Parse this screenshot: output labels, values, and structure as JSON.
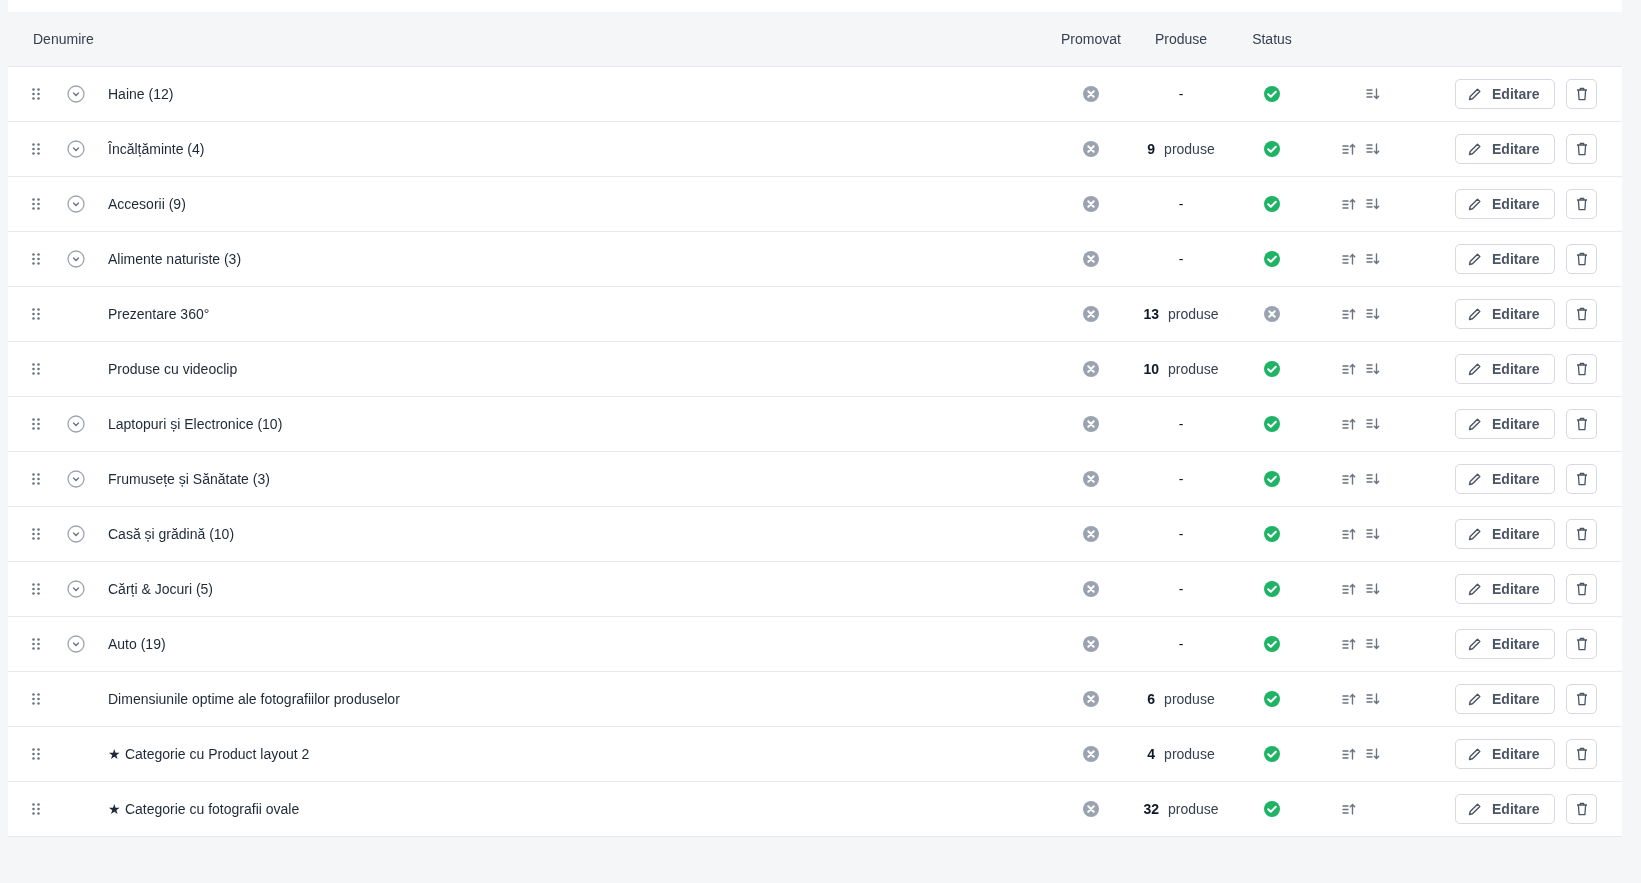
{
  "table": {
    "columns": [
      {
        "label": "Denumire"
      },
      {
        "label": "Promovat"
      },
      {
        "label": "Produse"
      },
      {
        "label": "Status"
      }
    ],
    "rows": [
      {
        "name": "Haine (12)",
        "expandable": true,
        "promoted": false,
        "products": {
          "empty": "-"
        },
        "active": true,
        "move_up": false,
        "move_down": true,
        "edit_label": "Editare"
      },
      {
        "name": "Încălțăminte (4)",
        "expandable": true,
        "promoted": false,
        "products": {
          "count": "9",
          "unit": "produse"
        },
        "active": true,
        "move_up": true,
        "move_down": true,
        "edit_label": "Editare"
      },
      {
        "name": "Accesorii (9)",
        "expandable": true,
        "promoted": false,
        "products": {
          "empty": "-"
        },
        "active": true,
        "move_up": true,
        "move_down": true,
        "edit_label": "Editare"
      },
      {
        "name": "Alimente naturiste (3)",
        "expandable": true,
        "promoted": false,
        "products": {
          "empty": "-"
        },
        "active": true,
        "move_up": true,
        "move_down": true,
        "edit_label": "Editare"
      },
      {
        "name": "Prezentare 360°",
        "expandable": false,
        "promoted": false,
        "products": {
          "count": "13",
          "unit": "produse"
        },
        "active": false,
        "move_up": true,
        "move_down": true,
        "edit_label": "Editare"
      },
      {
        "name": "Produse cu videoclip",
        "expandable": false,
        "promoted": false,
        "products": {
          "count": "10",
          "unit": "produse"
        },
        "active": true,
        "move_up": true,
        "move_down": true,
        "edit_label": "Editare"
      },
      {
        "name": "Laptopuri și Electronice (10)",
        "expandable": true,
        "promoted": false,
        "products": {
          "empty": "-"
        },
        "active": true,
        "move_up": true,
        "move_down": true,
        "edit_label": "Editare"
      },
      {
        "name": "Frumusețe și Sănătate (3)",
        "expandable": true,
        "promoted": false,
        "products": {
          "empty": "-"
        },
        "active": true,
        "move_up": true,
        "move_down": true,
        "edit_label": "Editare"
      },
      {
        "name": "Casă și grădină (10)",
        "expandable": true,
        "promoted": false,
        "products": {
          "empty": "-"
        },
        "active": true,
        "move_up": true,
        "move_down": true,
        "edit_label": "Editare"
      },
      {
        "name": "Cărți & Jocuri (5)",
        "expandable": true,
        "promoted": false,
        "products": {
          "empty": "-"
        },
        "active": true,
        "move_up": true,
        "move_down": true,
        "edit_label": "Editare"
      },
      {
        "name": "Auto (19)",
        "expandable": true,
        "promoted": false,
        "products": {
          "empty": "-"
        },
        "active": true,
        "move_up": true,
        "move_down": true,
        "edit_label": "Editare"
      },
      {
        "name": "Dimensiunile optime ale fotografiilor produselor",
        "expandable": false,
        "promoted": false,
        "products": {
          "count": "6",
          "unit": "produse"
        },
        "active": true,
        "move_up": true,
        "move_down": true,
        "edit_label": "Editare"
      },
      {
        "name": "★ Categorie cu Product layout 2",
        "expandable": false,
        "promoted": false,
        "products": {
          "count": "4",
          "unit": "produse"
        },
        "active": true,
        "move_up": true,
        "move_down": true,
        "edit_label": "Editare"
      },
      {
        "name": "★ Categorie cu fotografii ovale",
        "expandable": false,
        "promoted": false,
        "products": {
          "count": "32",
          "unit": "produse"
        },
        "active": true,
        "move_up": true,
        "move_down": false,
        "edit_label": "Editare"
      }
    ]
  }
}
